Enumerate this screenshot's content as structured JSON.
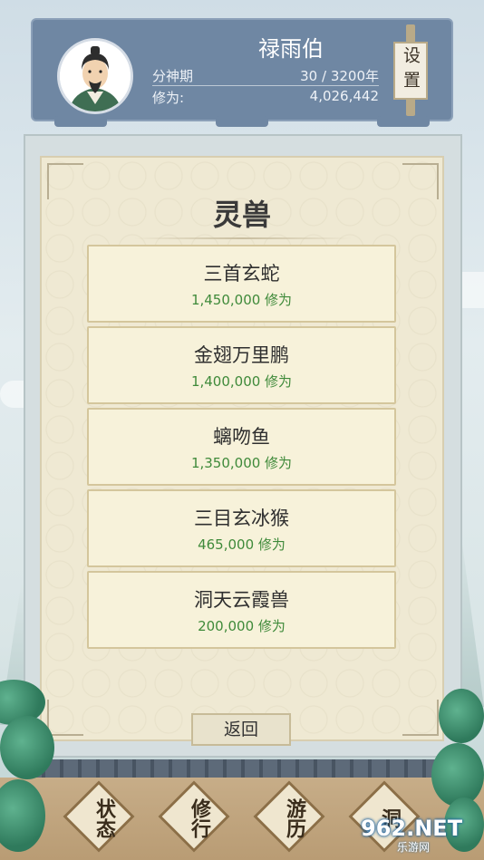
{
  "header": {
    "player_name": "禄雨伯",
    "realm_label": "分神期",
    "realm_progress": "30 / 3200年",
    "cultivation_label": "修为:",
    "cultivation_value": "4,026,442",
    "settings_label": "设置"
  },
  "panel": {
    "title": "灵兽",
    "beasts": [
      {
        "name": "三首玄蛇",
        "cost": "1,450,000 修为"
      },
      {
        "name": "金翅万里鹏",
        "cost": "1,400,000 修为"
      },
      {
        "name": "螭吻鱼",
        "cost": "1,350,000 修为"
      },
      {
        "name": "三目玄冰猴",
        "cost": "465,000 修为"
      },
      {
        "name": "洞天云霞兽",
        "cost": "200,000 修为"
      }
    ],
    "back_label": "返回"
  },
  "nav": {
    "tabs": [
      {
        "label": "状态"
      },
      {
        "label": "修行"
      },
      {
        "label": "游历"
      },
      {
        "label": "洞"
      }
    ]
  },
  "watermark": {
    "brand": "962.NET",
    "sub": "乐游网"
  },
  "colors": {
    "header_bg": "#6f87a3",
    "cost_green": "#3f8a3a",
    "card_bg": "#f7f2da"
  }
}
